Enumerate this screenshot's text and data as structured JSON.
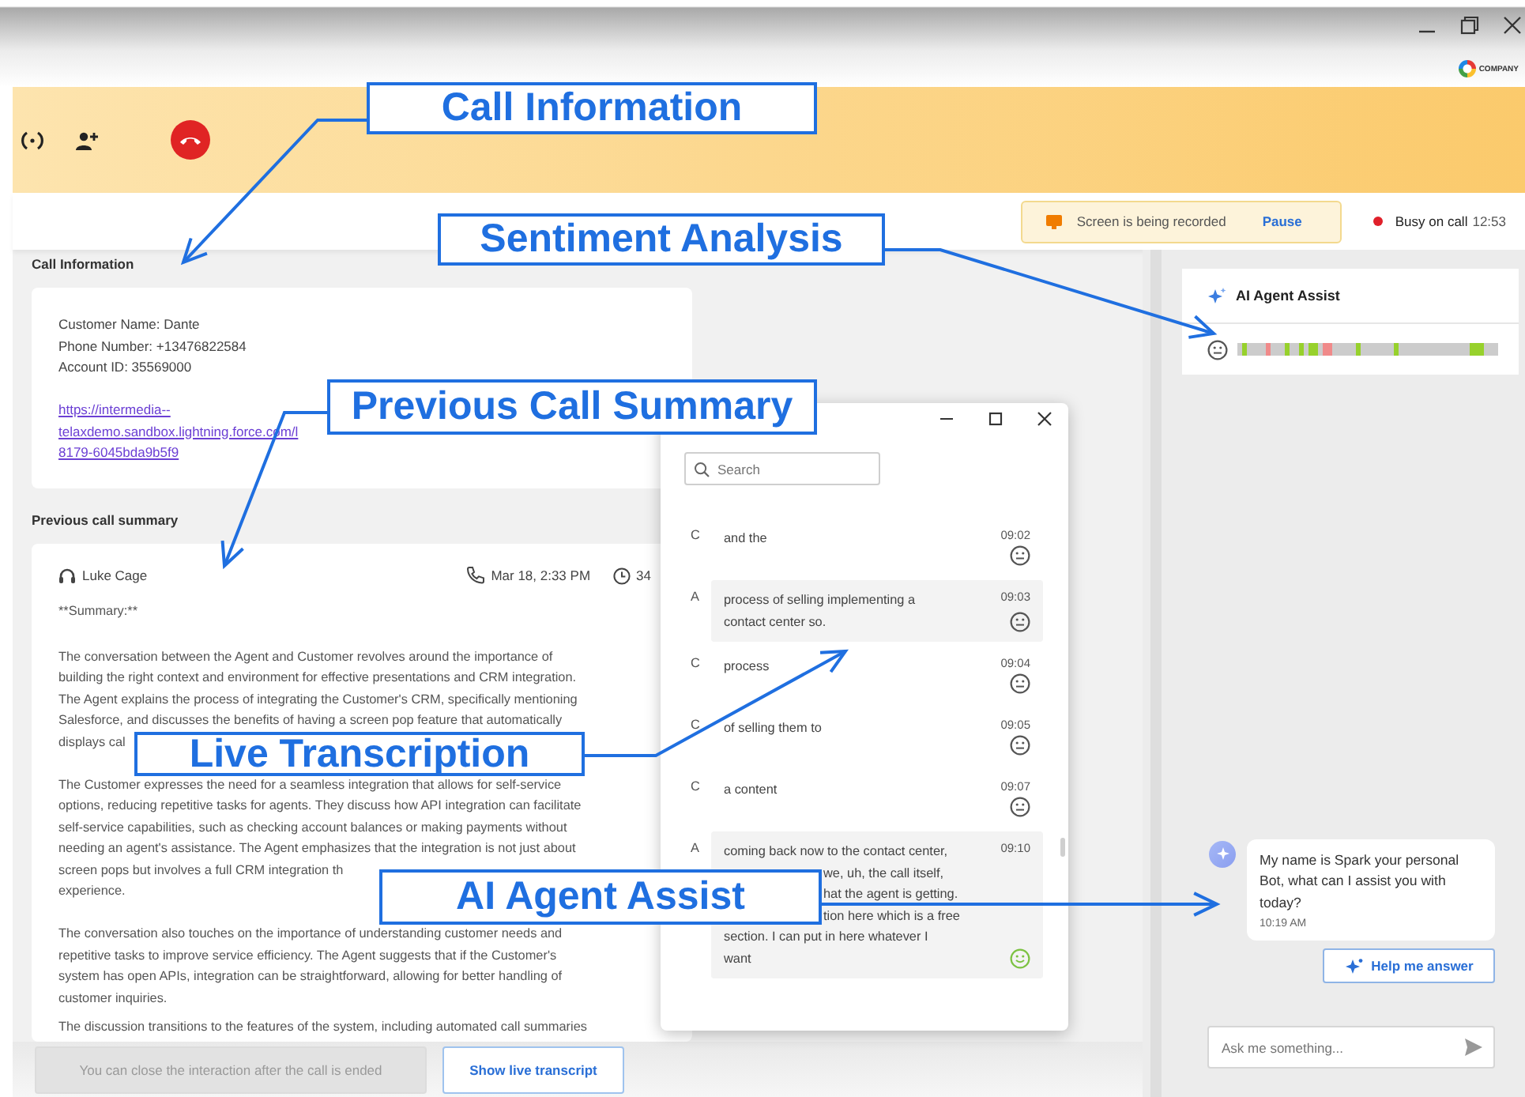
{
  "logo": {
    "text": "COMPANY"
  },
  "recording_notice": {
    "text": "Screen is being recorded",
    "action": "Pause"
  },
  "agent_status": {
    "label": "Busy on call",
    "timer": "12:53"
  },
  "call_information": {
    "heading": "Call Information",
    "lines": [
      "Customer Name: Dante",
      "Phone Number: +13476822584",
      "Account ID: 35569000"
    ],
    "link": [
      "https://intermedia--",
      "telaxdemo.sandbox.lightning.force.com/l",
      "8179-6045bda9b5f9"
    ]
  },
  "previous_call_summary": {
    "heading": "Previous call summary",
    "agent": "Luke Cage",
    "date": "Mar 18, 2:33 PM",
    "duration": "34",
    "title": "**Summary:**",
    "paragraphs": [
      {
        "kind": "paragraph",
        "lines": [
          "The conversation between the Agent and Customer revolves around the importance of",
          "building the right context and environment for effective presentations and CRM integration.",
          "The Agent explains the process of integrating the Customer's CRM, specifically mentioning",
          "Salesforce, and discusses the benefits of having a screen pop feature that automatically"
        ]
      },
      {
        "kind": "fragment",
        "lines": [
          "displays cal"
        ]
      },
      {
        "kind": "paragraph",
        "lines": [
          "The Customer expresses the need for a seamless integration that allows for self-service",
          "options, reducing repetitive tasks for agents. They discuss how API integration can facilitate",
          "self-service capabilities, such as checking account balances or making payments without",
          "needing an agent's assistance. The Agent emphasizes that the integration is not just about"
        ]
      },
      {
        "kind": "fragment",
        "lines": [
          "screen pops but involves a full CRM integration th",
          "experience."
        ]
      },
      {
        "kind": "paragraph",
        "lines": [
          "The conversation also touches on the importance of understanding customer needs and",
          "repetitive tasks to improve service efficiency. The Agent suggests that if the Customer's",
          "system has open APIs, integration can be straightforward, allowing for better handling of",
          "customer inquiries."
        ]
      },
      {
        "kind": "paragraph",
        "lines": [
          "The discussion transitions to the features of the system, including automated call summaries"
        ]
      }
    ]
  },
  "footer": {
    "close_notice": "You can close the interaction after the call is ended",
    "close_disabled": true,
    "transcript_button": "Show live transcript"
  },
  "ai_agent_assist": {
    "title": "AI Agent Assist",
    "sentiment_timeline": [
      {
        "color": "#cccccc"
      },
      {
        "color": "#97d12c"
      },
      {
        "color": "#cccccc"
      },
      {
        "color": "#cccccc"
      },
      {
        "color": "#cccccc"
      },
      {
        "color": "#cccccc"
      },
      {
        "color": "#f08a8a"
      },
      {
        "color": "#cccccc"
      },
      {
        "color": "#cccccc"
      },
      {
        "color": "#cccccc"
      },
      {
        "color": "#97d12c"
      },
      {
        "color": "#cccccc"
      },
      {
        "color": "#cccccc"
      },
      {
        "color": "#97d12c"
      },
      {
        "color": "#cccccc"
      },
      {
        "color": "#97d12c"
      },
      {
        "color": "#97d12c"
      },
      {
        "color": "#cccccc"
      },
      {
        "color": "#f08a8a"
      },
      {
        "color": "#f08a8a"
      },
      {
        "color": "#cccccc"
      },
      {
        "color": "#cccccc"
      },
      {
        "color": "#cccccc"
      },
      {
        "color": "#cccccc"
      },
      {
        "color": "#cccccc"
      },
      {
        "color": "#97d12c"
      },
      {
        "color": "#cccccc"
      },
      {
        "color": "#cccccc"
      },
      {
        "color": "#cccccc"
      },
      {
        "color": "#cccccc"
      },
      {
        "color": "#cccccc"
      },
      {
        "color": "#cccccc"
      },
      {
        "color": "#cccccc"
      },
      {
        "color": "#97d12c"
      },
      {
        "color": "#cccccc"
      },
      {
        "color": "#cccccc"
      },
      {
        "color": "#cccccc"
      },
      {
        "color": "#cccccc"
      },
      {
        "color": "#cccccc"
      },
      {
        "color": "#cccccc"
      },
      {
        "color": "#cccccc"
      },
      {
        "color": "#cccccc"
      },
      {
        "color": "#cccccc"
      },
      {
        "color": "#cccccc"
      },
      {
        "color": "#cccccc"
      },
      {
        "color": "#cccccc"
      },
      {
        "color": "#cccccc"
      },
      {
        "color": "#cccccc"
      },
      {
        "color": "#cccccc"
      },
      {
        "color": "#97d12c"
      },
      {
        "color": "#97d12c"
      },
      {
        "color": "#97d12c"
      },
      {
        "color": "#cccccc"
      },
      {
        "color": "#cccccc"
      },
      {
        "color": "#cccccc"
      }
    ],
    "messages": [
      {
        "text": "My name is Spark your personal Bot, what can I assist you with today?",
        "time": "10:19 AM"
      }
    ],
    "help_button": "Help me answer",
    "input": {
      "placeholder": "Ask me something..."
    }
  },
  "transcript_window": {
    "search": {
      "placeholder": "Search"
    },
    "entries": [
      {
        "speaker": "C",
        "segments": [
          {
            "kind": "full",
            "lines": [
              "and the"
            ]
          }
        ],
        "time": "09:02",
        "highlighted": false,
        "positive": false
      },
      {
        "speaker": "A",
        "segments": [
          {
            "kind": "full",
            "lines": [
              "process of selling implementing a",
              "contact center so."
            ]
          }
        ],
        "time": "09:03",
        "highlighted": true,
        "positive": false
      },
      {
        "speaker": "C",
        "segments": [
          {
            "kind": "full",
            "lines": [
              "process"
            ]
          }
        ],
        "time": "09:04",
        "highlighted": false,
        "positive": false
      },
      {
        "speaker": "C",
        "segments": [
          {
            "kind": "full",
            "lines": [
              "of selling them to"
            ]
          }
        ],
        "time": "09:05",
        "highlighted": false,
        "positive": false
      },
      {
        "speaker": "C",
        "segments": [
          {
            "kind": "full",
            "lines": [
              "a content"
            ]
          }
        ],
        "time": "09:07",
        "highlighted": false,
        "positive": false
      },
      {
        "speaker": "A",
        "segments": [
          {
            "kind": "full",
            "lines": [
              "coming back now to the contact center,"
            ]
          },
          {
            "kind": "cut",
            "lines": [
              "we, uh, the call itself,",
              "hat the agent is getting.",
              "tion here which is a free"
            ]
          },
          {
            "kind": "full",
            "lines": [
              "section. I can put in here whatever I",
              "want"
            ]
          }
        ],
        "time": "09:10",
        "highlighted": true,
        "positive": true
      }
    ]
  },
  "annotations": [
    {
      "text": "Call Information"
    },
    {
      "text": "Sentiment Analysis"
    },
    {
      "text": "Previous Call Summary"
    },
    {
      "text": "Live Transcription"
    },
    {
      "text": "AI Agent Assist"
    }
  ]
}
